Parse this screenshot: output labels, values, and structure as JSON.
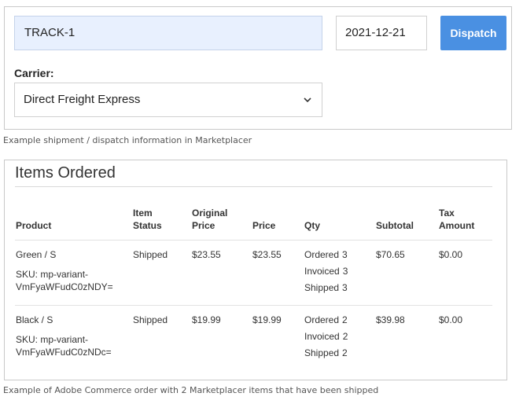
{
  "dispatch_form": {
    "tracking_value": "TRACK-1",
    "date_value": "2021-12-21",
    "dispatch_label": "Dispatch",
    "carrier_label": "Carrier:",
    "carrier_selected": "Direct Freight Express"
  },
  "captions": {
    "first": "Example shipment / dispatch information in Marketplacer",
    "second": "Example of Adobe Commerce order with 2 Marketplacer items that have been shipped"
  },
  "items_ordered": {
    "title": "Items Ordered",
    "headers": {
      "product": "Product",
      "item_status_1": "Item",
      "item_status_2": "Status",
      "original_price_1": "Original",
      "original_price_2": "Price",
      "price": "Price",
      "qty": "Qty",
      "subtotal": "Subtotal",
      "tax_amount_1": "Tax",
      "tax_amount_2": "Amount"
    },
    "rows": [
      {
        "product": "Green / S",
        "sku": "SKU: mp-variant-VmFyaWFudC0zNDY=",
        "status": "Shipped",
        "original_price": "$23.55",
        "price": "$23.55",
        "qty_ordered_label": "Ordered",
        "qty_ordered": "3",
        "qty_invoiced_label": "Invoiced",
        "qty_invoiced": "3",
        "qty_shipped_label": "Shipped",
        "qty_shipped": "3",
        "subtotal": "$70.65",
        "tax": "$0.00"
      },
      {
        "product": "Black / S",
        "sku": "SKU: mp-variant-VmFyaWFudC0zNDc=",
        "status": "Shipped",
        "original_price": "$19.99",
        "price": "$19.99",
        "qty_ordered_label": "Ordered",
        "qty_ordered": "2",
        "qty_invoiced_label": "Invoiced",
        "qty_invoiced": "2",
        "qty_shipped_label": "Shipped",
        "qty_shipped": "2",
        "subtotal": "$39.98",
        "tax": "$0.00"
      }
    ]
  },
  "icons": {
    "carrier_chevron": "chevron-down-icon"
  },
  "colors": {
    "dispatch_button": "#4a90e2",
    "tracking_fill": "#e8f0fe"
  }
}
